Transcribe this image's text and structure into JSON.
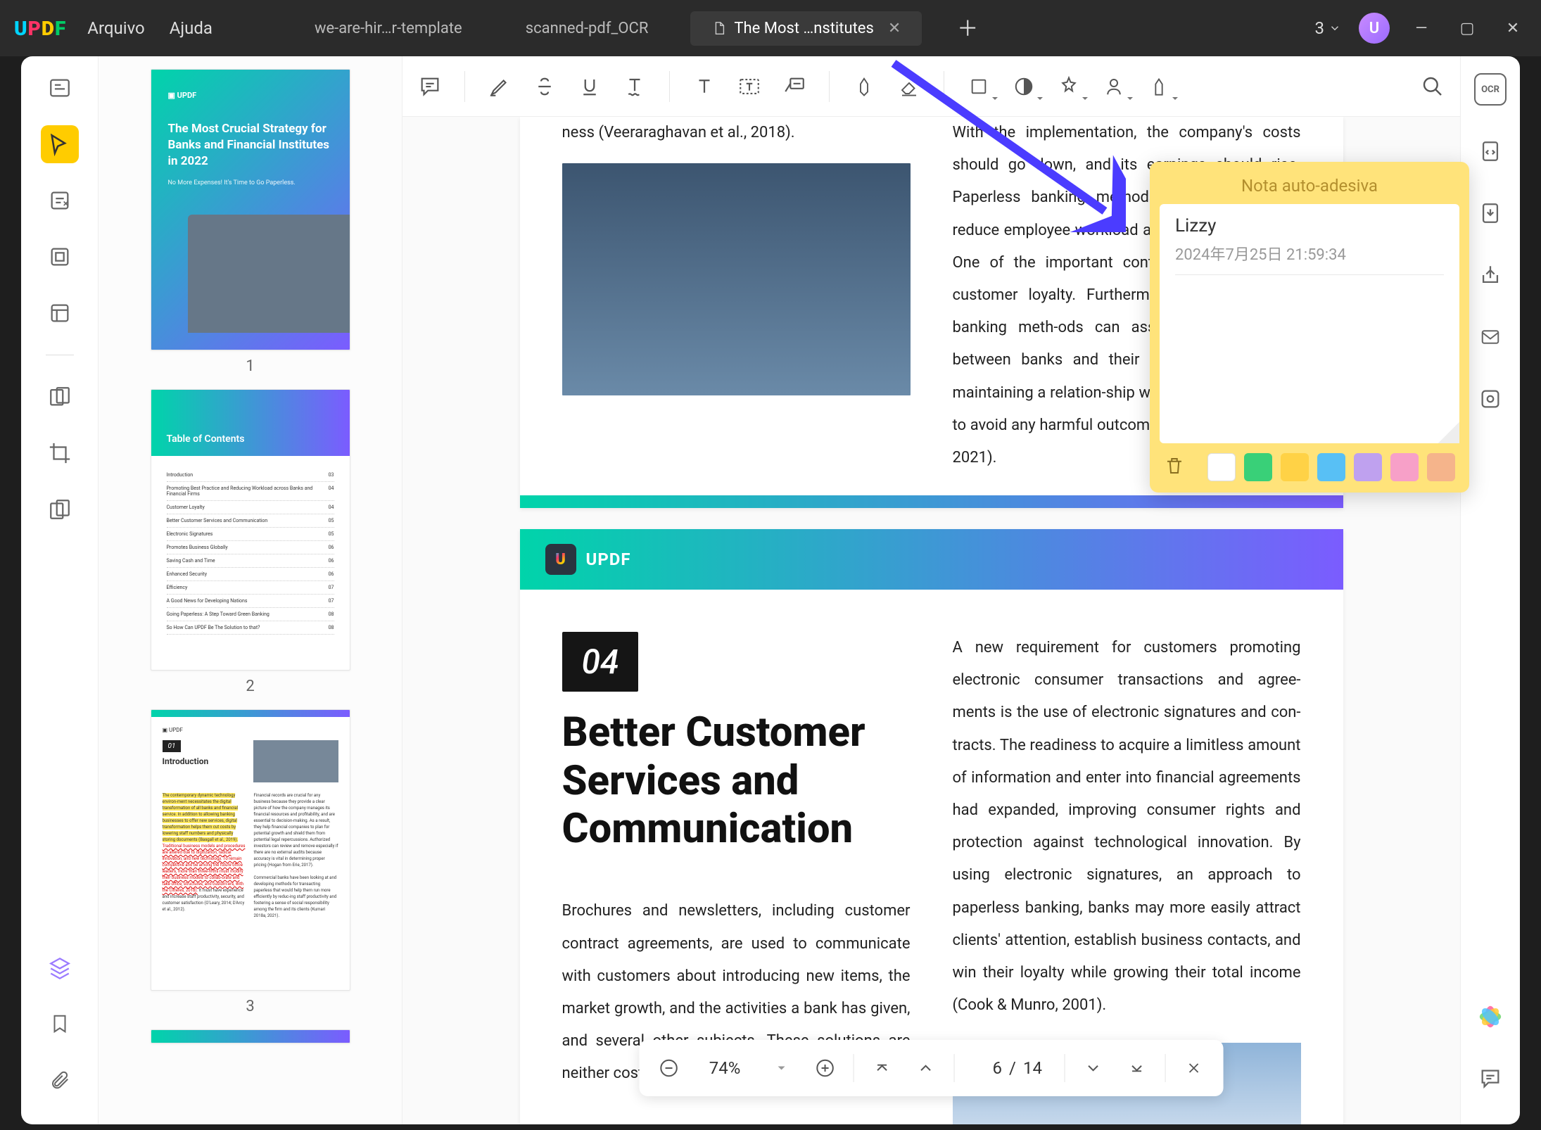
{
  "titlebar": {
    "menus": {
      "file": "Arquivo",
      "help": "Ajuda"
    },
    "tabs": [
      {
        "label": "we-are-hir…r-template"
      },
      {
        "label": "scanned-pdf_OCR"
      },
      {
        "label": "The Most …nstitutes",
        "active": true
      }
    ],
    "tabCount": "3",
    "avatarLetter": "U"
  },
  "thumbs": {
    "coverTitle": "The Most Crucial Strategy for Banks and Financial Institutes in 2022",
    "coverSub": "No More Expenses! It's Time to Go Paperless.",
    "tocTitle": "Table of Contents",
    "tocRows": [
      {
        "t": "Introduction",
        "p": "03"
      },
      {
        "t": "Promoting Best Practice and Reducing Workload across Banks and Financial Firms",
        "p": "04"
      },
      {
        "t": "Customer Loyalty",
        "p": "04"
      },
      {
        "t": "Better Customer Services and Communication",
        "p": "05"
      },
      {
        "t": "Electronic Signatures",
        "p": "05"
      },
      {
        "t": "Promotes Business Globally",
        "p": "06"
      },
      {
        "t": "Saving Cash and Time",
        "p": "06"
      },
      {
        "t": "Enhanced Security",
        "p": "06"
      },
      {
        "t": "Efficiency",
        "p": "07"
      },
      {
        "t": "A Good News for Developing Nations",
        "p": "07"
      },
      {
        "t": "Going Paperless: A Step Toward Green Banking",
        "p": "08"
      },
      {
        "t": "So How Can UPDF Be The Solution to that?",
        "p": "08"
      }
    ],
    "introChip": "01",
    "introH": "Introduction",
    "n1": "1",
    "n2": "2",
    "n3": "3"
  },
  "doc": {
    "p1_left_tail": "ness (Veeraraghavan et al., 2018).",
    "p1_right": "With the implementation, the company's costs should go down, and its earnings should rise. Paperless banking methods are anticipated to reduce employee workload and boost productivity. One of the important contributing elements is customer loyalty. Furthermore, using paperless banking meth-ods can assist to improve ties between banks and their clients. Building and maintaining a relation-ship with the client is crucial to avoid any harmful outcome to the bank (Kumari, 2021).",
    "brand": "UPDF",
    "chip": "04",
    "h2_1": "Better Customer",
    "h2_2": "Services and",
    "h2_3": "Communication",
    "left_body": "Brochures and newsletters, including customer contract agreements, are used to communicate with customers about introducing new items, the market growth, and the activities a bank has given, and several other subjects. These solutions are neither cost-effective nor manageable,",
    "right_body": "A new requirement for customers promoting electronic consumer transactions and agree-ments is the use of electronic signatures and con-tracts. The readiness to acquire a limitless amount of information and enter into financial agreements had expanded, improving consumer rights and protection against technological innovation. By using electronic signatures, an approach to paperless banking, banks may more easily attract clients' attention, establish business contacts, and win their loyalty while growing their total income (Cook & Munro, 2001)."
  },
  "sticky": {
    "title": "Nota auto-adesiva",
    "author": "Lizzy",
    "date": "2024年7月25日 21:59:34",
    "colors": [
      "#ffffff",
      "#39d078",
      "#ffd246",
      "#58c0f5",
      "#bfa1ef",
      "#f7a0c8",
      "#f5b48b"
    ]
  },
  "nav": {
    "zoom": "74%",
    "current": "6",
    "sep": "/",
    "total": "14"
  }
}
